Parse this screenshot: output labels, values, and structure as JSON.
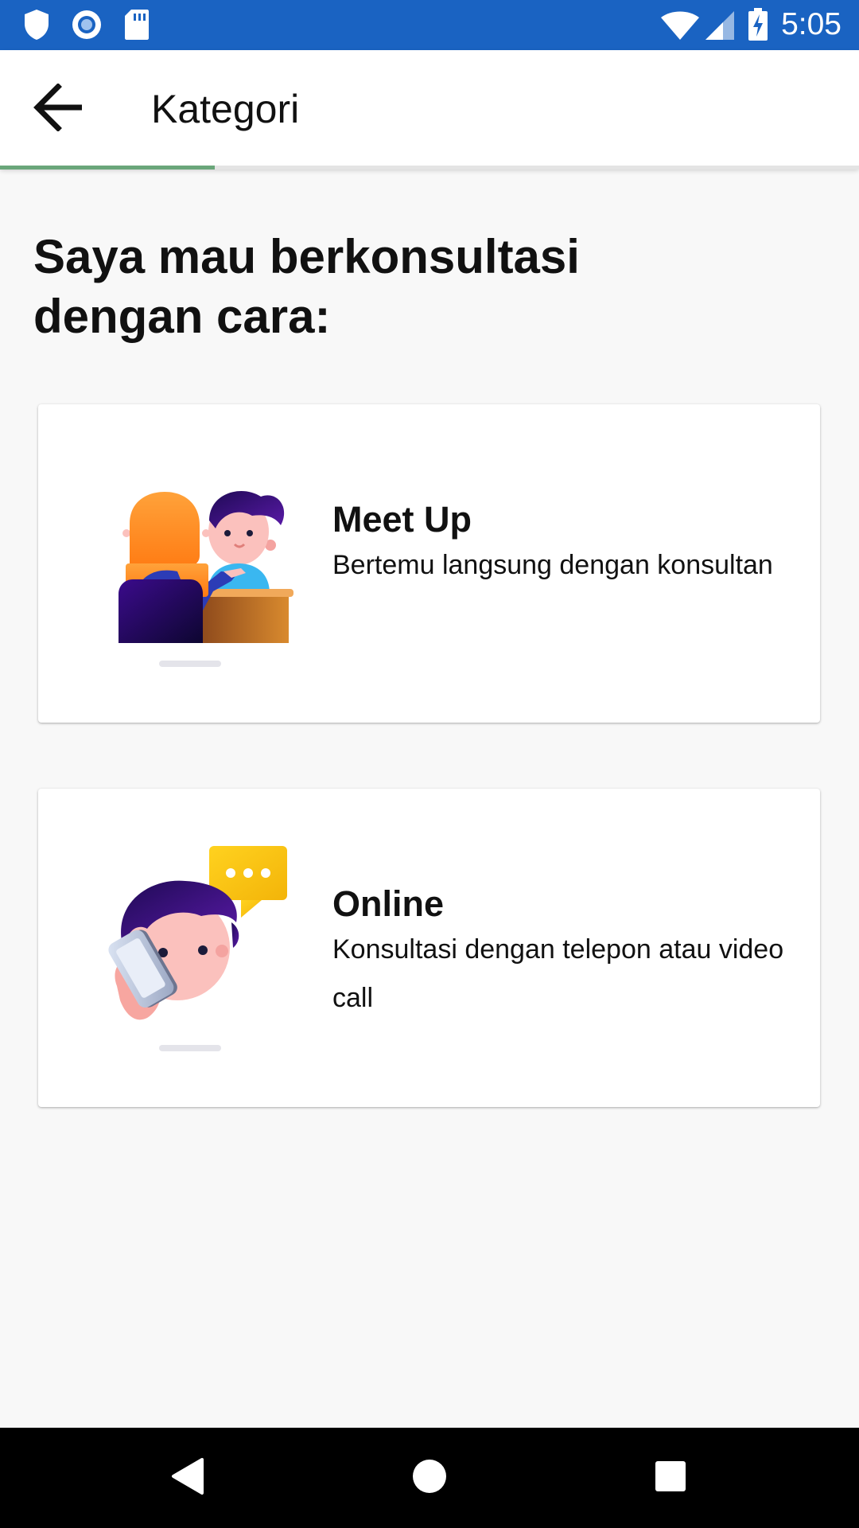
{
  "status_bar": {
    "time": "5:05",
    "icons": [
      "shield-icon",
      "circle-record-icon",
      "sd-card-icon",
      "wifi-icon",
      "signal-icon",
      "battery-charging-icon"
    ]
  },
  "app_bar": {
    "title": "Kategori",
    "back_icon": "arrow-left-icon",
    "progress": 0.25,
    "progress_color": "#6aa67a"
  },
  "main": {
    "heading": "Saya mau berkonsultasi dengan cara:",
    "options": [
      {
        "title": "Meet Up",
        "description": "Bertemu langsung dengan konsultan",
        "icon": "meetup-illustration-icon"
      },
      {
        "title": "Online",
        "description": "Konsultasi dengan telepon atau video call",
        "icon": "phone-call-illustration-icon"
      }
    ]
  },
  "nav_bar": {
    "buttons": [
      "back-triangle-icon",
      "home-circle-icon",
      "recents-square-icon"
    ]
  },
  "colors": {
    "status_bar": "#1a63c2",
    "background": "#f8f8f8",
    "card": "#ffffff"
  }
}
